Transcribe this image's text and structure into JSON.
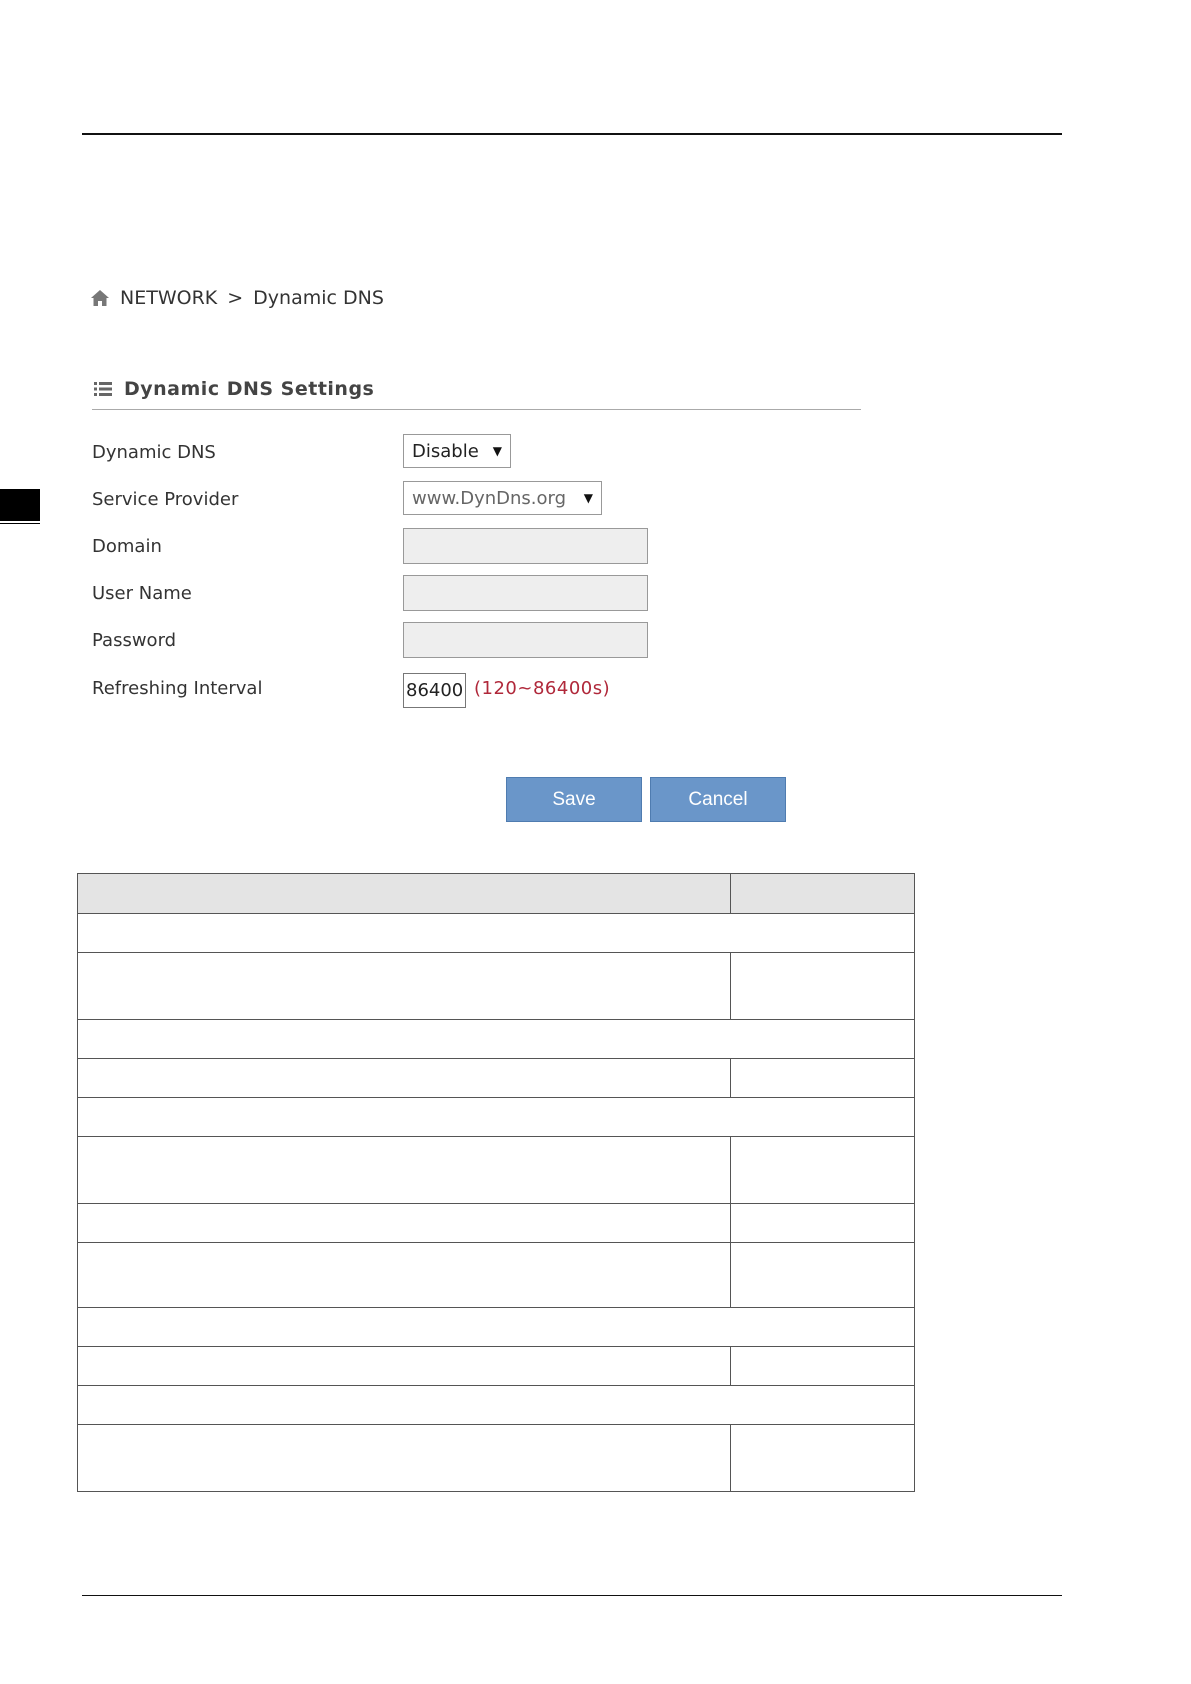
{
  "breadcrumb": {
    "section": "NETWORK",
    "separator": ">",
    "page": "Dynamic DNS"
  },
  "section": {
    "title": "Dynamic DNS Settings"
  },
  "form": {
    "dynamic_dns": {
      "label": "Dynamic DNS",
      "value": "Disable"
    },
    "service_provider": {
      "label": "Service Provider",
      "value": "www.DynDns.org"
    },
    "domain": {
      "label": "Domain",
      "value": ""
    },
    "user_name": {
      "label": "User Name",
      "value": ""
    },
    "password": {
      "label": "Password",
      "value": ""
    },
    "refreshing_interval": {
      "label": "Refreshing Interval",
      "value": "86400",
      "hint": "(120~86400s)"
    }
  },
  "buttons": {
    "save": "Save",
    "cancel": "Cancel"
  },
  "icons": {
    "home": "home-icon",
    "list": "list-icon",
    "dropdown": "chevron-down-icon"
  },
  "colors": {
    "button": "#6a96c9",
    "hint": "#b0283a",
    "disabled_input": "#eeeeee"
  }
}
